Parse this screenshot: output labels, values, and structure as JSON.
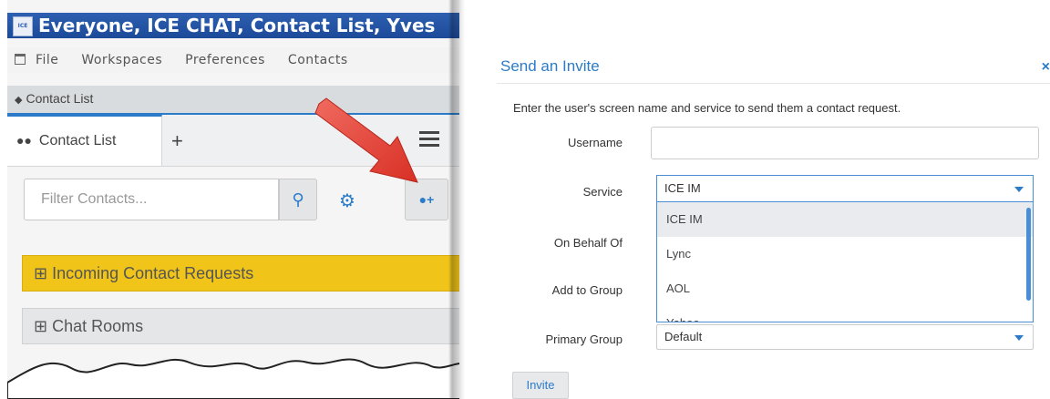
{
  "app": {
    "title": "Everyone, ICE CHAT, Contact List, Yves",
    "icon_text": "ICE",
    "menu": [
      "File",
      "Workspaces",
      "Preferences",
      "Contacts"
    ],
    "section_header": "Contact List",
    "tab_label": "Contact List",
    "tab_add": "+",
    "filter_placeholder": "Filter Contacts...",
    "groups": {
      "incoming": "⊞ Incoming Contact Requests",
      "chatrooms": "⊞ Chat Rooms"
    },
    "icons": {
      "search": "search-icon",
      "gears": "gears-icon",
      "add_contact": "add-user-icon",
      "hamburger": "hamburger-icon"
    }
  },
  "dialog": {
    "title": "Send an Invite",
    "close": "×",
    "description": "Enter the user's screen name and service to send them a contact request.",
    "labels": {
      "username": "Username",
      "service": "Service",
      "on_behalf_of": "On Behalf Of",
      "add_to_group": "Add to Group",
      "primary_group": "Primary Group"
    },
    "username_value": "",
    "service_value": "ICE IM",
    "service_options": [
      "ICE IM",
      "Lync",
      "AOL",
      "Yahoo"
    ],
    "primary_group_value": "Default",
    "invite_button": "Invite"
  },
  "colors": {
    "accent": "#2b7bc8",
    "title_bar": "#1c4a99",
    "incoming_bar": "#f0c419",
    "arrow": "#e8423a"
  }
}
